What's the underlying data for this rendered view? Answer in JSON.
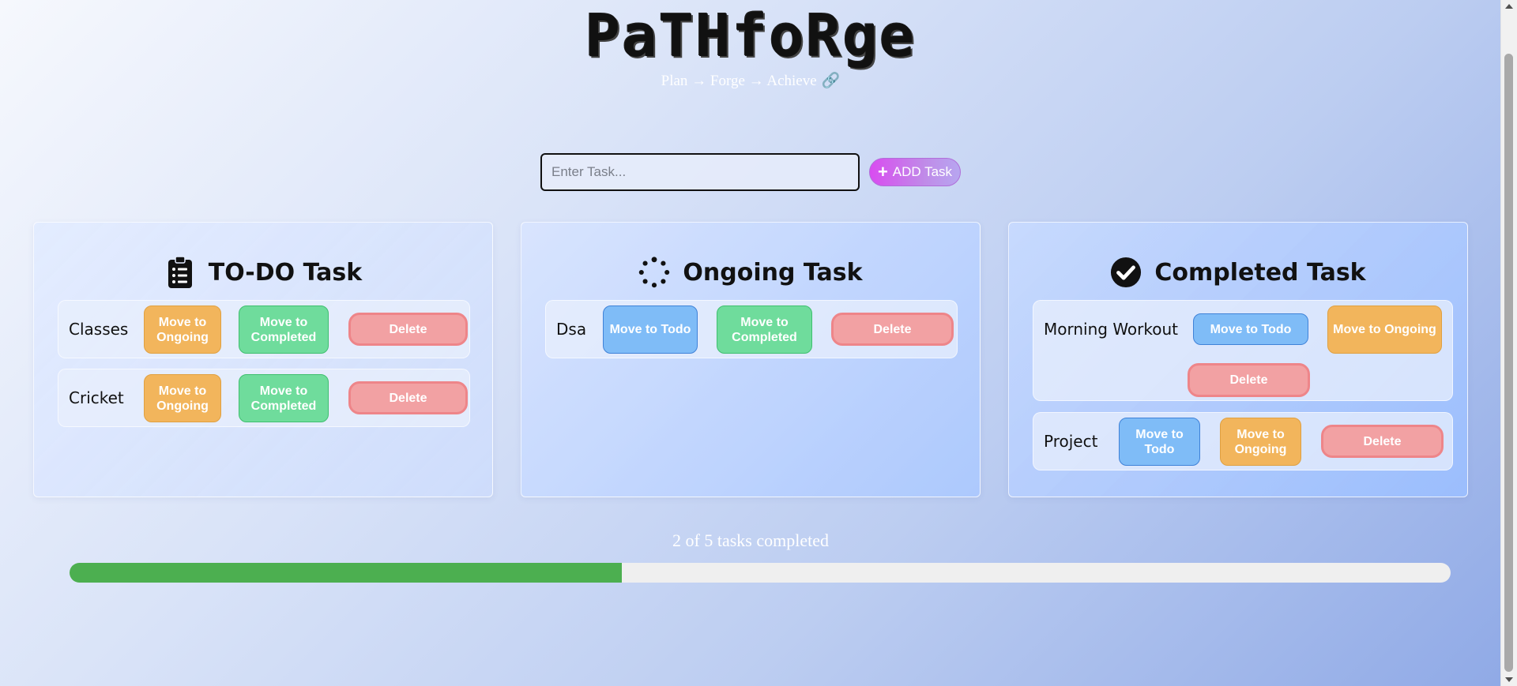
{
  "app": {
    "title": "PaTHfoRge",
    "subtitle": "Plan → Forge → Achieve",
    "subtitle_icon": "link-icon"
  },
  "input": {
    "placeholder": "Enter Task...",
    "value": ""
  },
  "add_button": {
    "label": "ADD Task",
    "icon": "plus-icon",
    "color": "#d94cf0"
  },
  "columns": {
    "todo": {
      "title": "TO-DO Task",
      "icon": "clipboard-list-icon",
      "tasks": [
        {
          "name": "Classes",
          "buttons": [
            "Move to Ongoing",
            "Move to Completed",
            "Delete"
          ]
        },
        {
          "name": "Cricket",
          "buttons": [
            "Move to Ongoing",
            "Move to Completed",
            "Delete"
          ]
        }
      ]
    },
    "ongoing": {
      "title": "Ongoing Task",
      "icon": "spinner-icon",
      "tasks": [
        {
          "name": "Dsa",
          "buttons": [
            "Move to Todo",
            "Move to Completed",
            "Delete"
          ]
        }
      ]
    },
    "completed": {
      "title": "Completed Task",
      "icon": "check-circle-icon",
      "tasks": [
        {
          "name": "Morning Workout",
          "buttons": [
            "Move to Todo",
            "Move to Ongoing",
            "Delete"
          ]
        },
        {
          "name": "Project",
          "buttons": [
            "Move to Todo",
            "Move to Ongoing",
            "Delete"
          ]
        }
      ]
    }
  },
  "progress": {
    "text": "2 of 5 tasks completed",
    "completed": 2,
    "total": 5,
    "fraction": 0.4,
    "fill_color": "#4caf50"
  },
  "colors": {
    "move_ongoing": "#f2b55c",
    "move_completed": "#6fdc9c",
    "move_todo": "#7fbcf7",
    "delete": "#f2a1a3"
  }
}
